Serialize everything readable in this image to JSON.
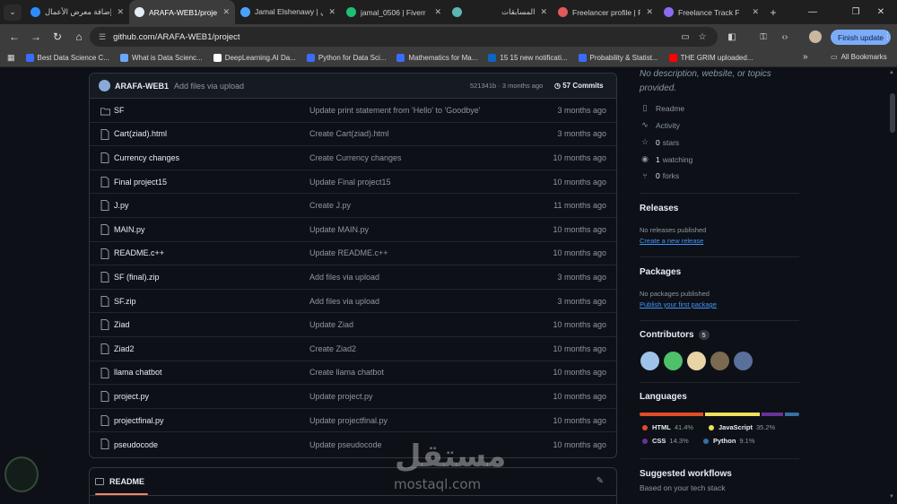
{
  "browser": {
    "tabs": [
      {
        "title": "إضافة معرض الأعمال",
        "color": "#2d8cff"
      },
      {
        "title": "ARAFA-WEB1/project",
        "color": "#e6edf3",
        "active": true
      },
      {
        "title": "Jamal Elshenawy | ليي",
        "color": "#4aa3ff"
      },
      {
        "title": "jamal_0506 | Fiverr",
        "color": "#1dbf73"
      },
      {
        "title": "المسابقات",
        "color": "#5bb8b0"
      },
      {
        "title": "Freelancer profile | F",
        "color": "#e05a5a"
      },
      {
        "title": "Freelance Track F",
        "color": "#8a6cf0"
      }
    ],
    "url": "github.com/ARAFA-WEB1/project",
    "finish_update": "Finish update",
    "bookmarks": [
      {
        "label": "Best Data Science C...",
        "color": "#3b6cff"
      },
      {
        "label": "What is Data Scienc...",
        "color": "#6aa7ff"
      },
      {
        "label": "DeepLearning.AI Da...",
        "color": "#ffffff"
      },
      {
        "label": "Python for Data Sci...",
        "color": "#3b6cff"
      },
      {
        "label": "Mathematics for Ma...",
        "color": "#3b6cff"
      },
      {
        "label": "15 15 new notificati...",
        "color": "#0a66c2"
      },
      {
        "label": "Probability & Statist...",
        "color": "#3b6cff"
      },
      {
        "label": "THE GRIM uploaded...",
        "color": "#ff0000"
      }
    ],
    "all_bookmarks": "All Bookmarks"
  },
  "commit": {
    "user": "ARAFA-WEB1",
    "message": "Add files via upload",
    "hash": "521341b · 3 months ago",
    "commits": "57 Commits"
  },
  "files": [
    {
      "name": "SF",
      "type": "folder",
      "message": "Update print statement from 'Hello' to 'Goodbye'",
      "date": "3 months ago"
    },
    {
      "name": "Cart(ziad).html",
      "type": "file",
      "message": "Create Cart(ziad).html",
      "date": "3 months ago"
    },
    {
      "name": "Currency changes",
      "type": "file",
      "message": "Create Currency changes",
      "date": "10 months ago"
    },
    {
      "name": "Final project15",
      "type": "file",
      "message": "Update Final project15",
      "date": "10 months ago"
    },
    {
      "name": "J.py",
      "type": "file",
      "message": "Create J.py",
      "date": "11 months ago"
    },
    {
      "name": "MAIN.py",
      "type": "file",
      "message": "Update MAIN.py",
      "date": "10 months ago"
    },
    {
      "name": "README.c++",
      "type": "file",
      "message": "Update README.c++",
      "date": "10 months ago"
    },
    {
      "name": "SF (final).zip",
      "type": "file",
      "message": "Add files via upload",
      "date": "3 months ago"
    },
    {
      "name": "SF.zip",
      "type": "file",
      "message": "Add files via upload",
      "date": "3 months ago"
    },
    {
      "name": "Ziad",
      "type": "file",
      "message": "Update Ziad",
      "date": "10 months ago"
    },
    {
      "name": "Ziad2",
      "type": "file",
      "message": "Create Ziad2",
      "date": "10 months ago"
    },
    {
      "name": "llama chatbot",
      "type": "file",
      "message": "Create llama chatbot",
      "date": "10 months ago"
    },
    {
      "name": "project.py",
      "type": "file",
      "message": "Update project.py",
      "date": "10 months ago"
    },
    {
      "name": "projectfinal.py",
      "type": "file",
      "message": "Update projectfinal.py",
      "date": "10 months ago"
    },
    {
      "name": "pseudocode",
      "type": "file",
      "message": "Update pseudocode",
      "date": "10 months ago"
    }
  ],
  "readme": {
    "tab": "README"
  },
  "sidebar": {
    "about": "No description, website, or topics provided.",
    "meta": {
      "readme": "Readme",
      "activity": "Activity",
      "stars_count": "0",
      "stars": "stars",
      "watching_count": "1",
      "watching": "watching",
      "forks_count": "0",
      "forks": "forks"
    },
    "releases": {
      "title": "Releases",
      "text": "No releases published",
      "link": "Create a new release"
    },
    "packages": {
      "title": "Packages",
      "text": "No packages published",
      "link": "Publish your first package"
    },
    "contributors": {
      "title": "Contributors",
      "count": "5",
      "avatars": [
        "#9fc3e8",
        "#4fbf6a",
        "#e8d3a6",
        "#7a6a50",
        "#5a6f9a"
      ]
    },
    "languages": {
      "title": "Languages",
      "items": [
        {
          "name": "HTML",
          "percent": "41.4%",
          "value": 41.4,
          "color": "#e34c26"
        },
        {
          "name": "JavaScript",
          "percent": "35.2%",
          "value": 35.2,
          "color": "#f1e05a"
        },
        {
          "name": "CSS",
          "percent": "14.3%",
          "value": 14.3,
          "color": "#663399"
        },
        {
          "name": "Python",
          "percent": "9.1%",
          "value": 9.1,
          "color": "#3572A5"
        }
      ]
    },
    "workflows": {
      "title": "Suggested workflows",
      "text": "Based on your tech stack"
    }
  },
  "watermark": {
    "text": "مستقل",
    "sub": "mostaql.com"
  }
}
